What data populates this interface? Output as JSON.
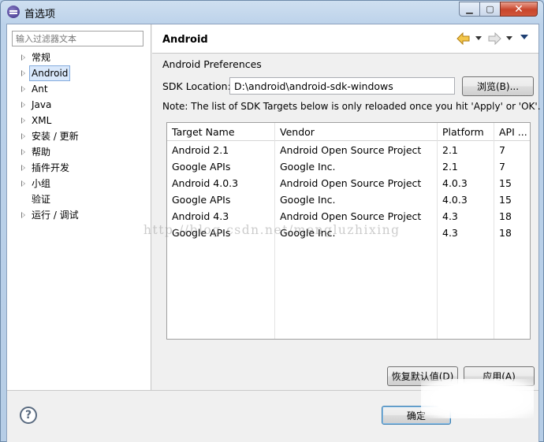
{
  "window": {
    "title": "首选项",
    "minimize_label": "▁",
    "maximize_label": "▢",
    "close_label": "✕"
  },
  "filter": {
    "placeholder": "输入过滤器文本"
  },
  "tree": {
    "items": [
      {
        "label": "常规",
        "expandable": true
      },
      {
        "label": "Android",
        "expandable": true,
        "selected": true
      },
      {
        "label": "Ant",
        "expandable": true
      },
      {
        "label": "Java",
        "expandable": true
      },
      {
        "label": "XML",
        "expandable": true
      },
      {
        "label": "安装 / 更新",
        "expandable": true
      },
      {
        "label": "帮助",
        "expandable": true
      },
      {
        "label": "插件开发",
        "expandable": true
      },
      {
        "label": "小组",
        "expandable": true
      },
      {
        "label": "验证",
        "expandable": false
      },
      {
        "label": "运行 / 调试",
        "expandable": true
      }
    ]
  },
  "page": {
    "title": "Android",
    "prefs_title": "Android Preferences",
    "sdk_label": "SDK Location:",
    "sdk_value": "D:\\android\\android-sdk-windows",
    "browse_label": "浏览(B)...",
    "note": "Note: The list of SDK Targets below is only reloaded once you hit 'Apply' or 'OK'.",
    "restore_defaults_label": "恢复默认值(D)",
    "apply_label": "应用(A)"
  },
  "table": {
    "headers": [
      "Target Name",
      "Vendor",
      "Platform",
      "API ..."
    ],
    "rows": [
      [
        "Android 2.1",
        "Android Open Source Project",
        "2.1",
        "7"
      ],
      [
        "Google APIs",
        "Google Inc.",
        "2.1",
        "7"
      ],
      [
        "Android 4.0.3",
        "Android Open Source Project",
        "4.0.3",
        "15"
      ],
      [
        "Google APIs",
        "Google Inc.",
        "4.0.3",
        "15"
      ],
      [
        "Android 4.3",
        "Android Open Source Project",
        "4.3",
        "18"
      ],
      [
        "Google APIs",
        "Google Inc.",
        "4.3",
        "18"
      ]
    ]
  },
  "watermark": "http://blog.csdn.net/mengluzhixing",
  "bottom": {
    "help_label": "?",
    "ok_label": "确定"
  }
}
